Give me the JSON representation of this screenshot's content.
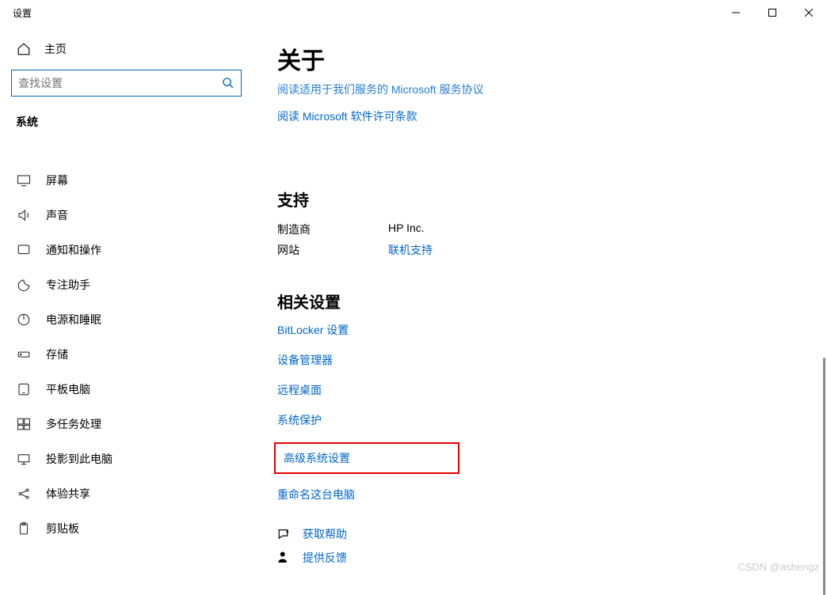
{
  "window": {
    "title": "设置"
  },
  "sidebar": {
    "home": "主页",
    "search_placeholder": "查找设置",
    "section": "系统",
    "items": [
      {
        "icon": "display-icon",
        "label": "屏幕"
      },
      {
        "icon": "sound-icon",
        "label": "声音"
      },
      {
        "icon": "notify-icon",
        "label": "通知和操作"
      },
      {
        "icon": "focus-icon",
        "label": "专注助手"
      },
      {
        "icon": "power-icon",
        "label": "电源和睡眠"
      },
      {
        "icon": "storage-icon",
        "label": "存储"
      },
      {
        "icon": "tablet-icon",
        "label": "平板电脑"
      },
      {
        "icon": "multitask-icon",
        "label": "多任务处理"
      },
      {
        "icon": "project-icon",
        "label": "投影到此电脑"
      },
      {
        "icon": "share-icon",
        "label": "体验共享"
      },
      {
        "icon": "clipboard-icon",
        "label": "剪贴板"
      }
    ]
  },
  "page": {
    "title": "关于",
    "truncated_link": "阅读适用于我们服务的 Microsoft 服务协议",
    "license_link": "阅读 Microsoft 软件许可条款",
    "support": {
      "heading": "支持",
      "manufacturer_label": "制造商",
      "manufacturer_value": "HP Inc.",
      "website_label": "网站",
      "website_value": "联机支持"
    },
    "related": {
      "heading": "相关设置",
      "items": [
        "BitLocker 设置",
        "设备管理器",
        "远程桌面",
        "系统保护",
        "高级系统设置",
        "重命名这台电脑"
      ]
    },
    "help": {
      "get_help": "获取帮助",
      "feedback": "提供反馈"
    }
  },
  "watermark": "CSDN @ashengz"
}
